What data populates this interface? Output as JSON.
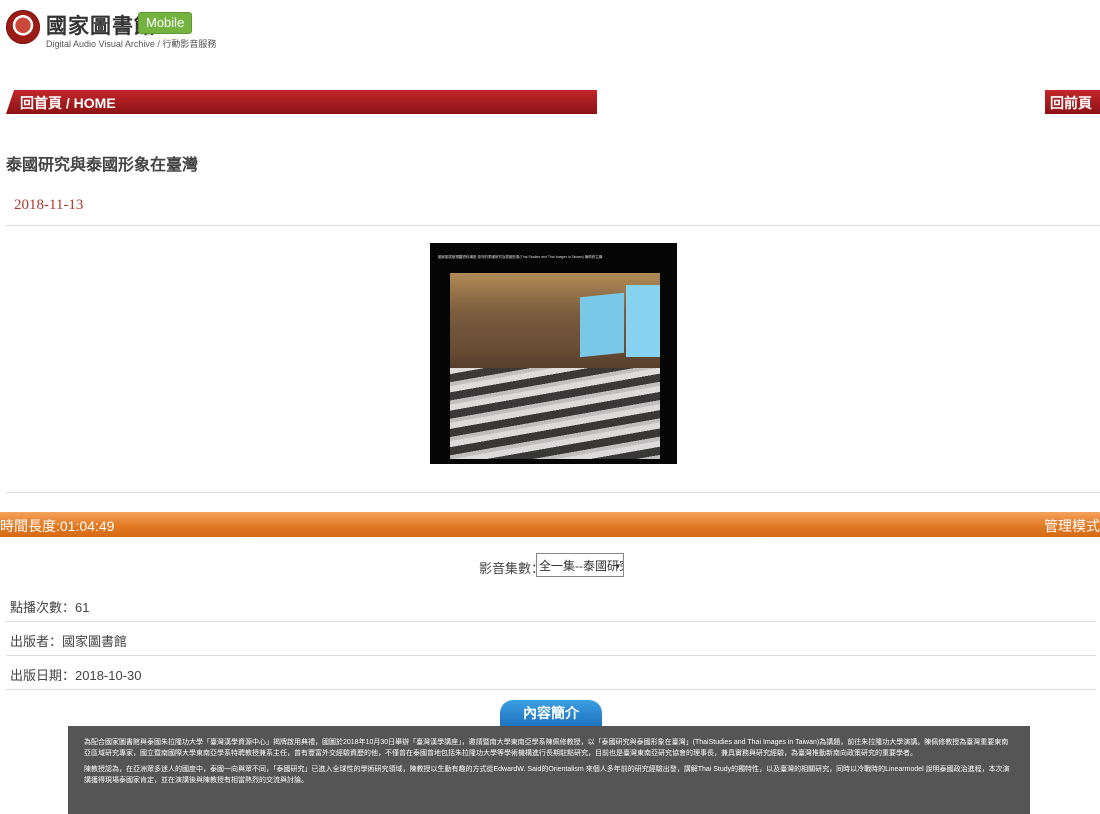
{
  "header": {
    "brand_name": "國家圖書館",
    "mobile_badge": "Mobile",
    "subtitle": "Digital Audio Visual Archive / 行動影音服務"
  },
  "nav": {
    "home": "回首頁 / HOME",
    "back": "回前頁"
  },
  "page": {
    "title": "泰國研究與泰國形象在臺灣",
    "date": "2018-11-13"
  },
  "video": {
    "caption": "國家圖書館視聽資料講座  臺灣的泰國研究及泰國形象(Thai Studies and Thai Images in Taiwan)  陳佩修主講",
    "icon": "video-thumbnail"
  },
  "duration_bar": {
    "duration": "時間長度:01:04:49",
    "manage": "管理模式"
  },
  "episode": {
    "label": "影音集數：",
    "selected": "全一集--泰國研究"
  },
  "meta": {
    "views": "點播次數：61",
    "publisher": "出版者：國家圖書館",
    "publish_date": "出版日期：2018-10-30"
  },
  "intro": {
    "tab_label": "內容簡介",
    "paragraph1": "為配合國家圖書館與泰國朱拉隆功大學「臺灣漢學資源中心」揭牌啟用典禮，國圖於2018年10月30日舉辦「臺灣漢學講座」，邀請暨南大學東南亞學系陳佩修教授，以「泰國研究與泰國形象在臺灣」(ThaiStudies and Thai Images in Taiwan)為講題，前往朱拉隆功大學演講。陳佩修教授為臺灣重要東南亞區域研究專家，國立暨南國際大學東南亞學系特聘教授兼系主任，曾有豐富外交經驗資歷的他，不僅曾在泰國曾地包括朱拉隆功大學等學術機構進行長期駐點研究，目前也是臺灣東南亞研究協會的理事長，兼具實務與研究經驗，為臺灣推動新南向政策研究的重要學者。",
    "paragraph2": "陳教授認為，在亞洲眾多迷人的國度中，泰國一向與眾不同，「泰國研究」已進入全球性的學術研究領域，陳教授以生動有趣的方式從EdwardW. Said的Orientalism 來個人多年前的研究經驗出發，講解Thai Study的獨特性，以及臺灣的相關研究，同時以冷戰時的Linearmodel 說明泰國政治進程，本次演講獲得現場泰國家肯定，並在演講後與陳教授有相當熱烈的交流與討論。"
  },
  "colors": {
    "nav_red": "#b0191d",
    "duration_orange": "#e27a24",
    "date_red": "#b03a2e",
    "intro_blue": "#2a86d0",
    "intro_gray": "#555555",
    "mobile_green": "#74b33f"
  }
}
